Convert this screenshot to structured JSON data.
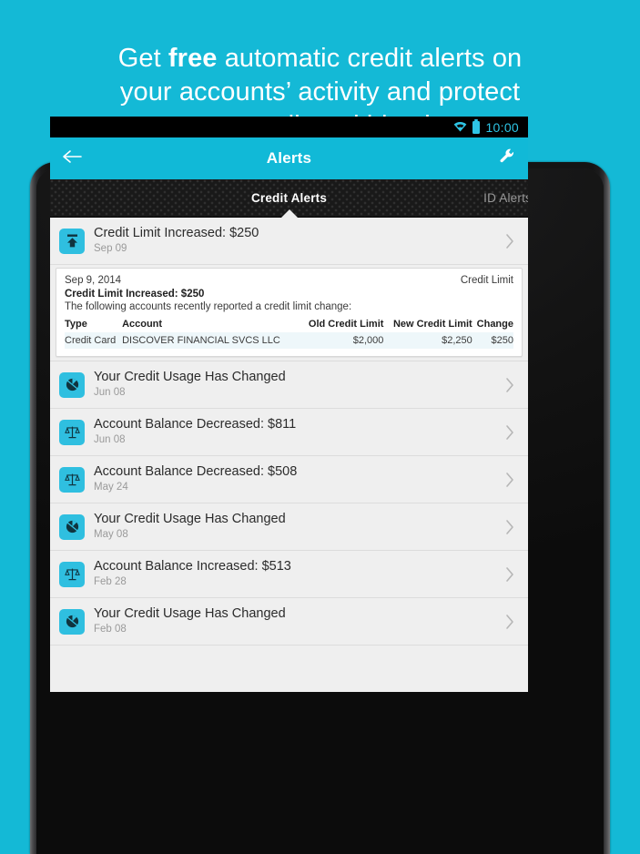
{
  "marketing": {
    "line1_pre": "Get ",
    "line1_bold": "free",
    "line1_post": " automatic credit alerts on",
    "line2": "your accounts’ activity and protect",
    "line3": "your credit and identity."
  },
  "colors": {
    "brand_teal": "#14b9d6",
    "appbar_teal": "#11b9d7",
    "icon_teal": "#2fbfe0",
    "status_accent": "#2ec5e6",
    "list_bg": "#efefef",
    "tab_inactive": "#9a9a9a"
  },
  "statusbar": {
    "wifi_icon": "wifi-icon",
    "battery_icon": "battery-icon",
    "time": "10:00"
  },
  "appbar": {
    "back_icon": "back-arrow-icon",
    "title": "Alerts",
    "settings_icon": "wrench-icon"
  },
  "tabs": [
    {
      "id": "credit-alerts",
      "label": "Credit Alerts",
      "active": true
    },
    {
      "id": "id-alerts",
      "label": "ID Alerts",
      "active": false
    }
  ],
  "alerts": [
    {
      "icon": "credit-limit-increase-icon",
      "title": "Credit Limit Increased: $250",
      "date": "Sep 09",
      "chevron": "chevron-right-icon",
      "expanded": true
    },
    {
      "icon": "credit-usage-pie-icon",
      "title": "Your Credit Usage Has Changed",
      "date": "Jun 08",
      "chevron": "chevron-right-icon",
      "expanded": false
    },
    {
      "icon": "account-balance-scales-icon",
      "title": "Account Balance Decreased: $811",
      "date": "Jun 08",
      "chevron": "chevron-right-icon",
      "expanded": false
    },
    {
      "icon": "account-balance-scales-icon",
      "title": "Account Balance Decreased: $508",
      "date": "May 24",
      "chevron": "chevron-right-icon",
      "expanded": false
    },
    {
      "icon": "credit-usage-pie-icon",
      "title": "Your Credit Usage Has Changed",
      "date": "May 08",
      "chevron": "chevron-right-icon",
      "expanded": false
    },
    {
      "icon": "account-balance-scales-icon",
      "title": "Account Balance Increased: $513",
      "date": "Feb 28",
      "chevron": "chevron-right-icon",
      "expanded": false
    },
    {
      "icon": "credit-usage-pie-icon",
      "title": "Your Credit Usage Has Changed",
      "date": "Feb 08",
      "chevron": "chevron-right-icon",
      "expanded": false
    }
  ],
  "detail": {
    "date": "Sep 9, 2014",
    "category": "Credit Limit",
    "heading": "Credit Limit Increased: $250",
    "description": "The following accounts recently reported a credit limit change:",
    "columns": [
      "Type",
      "Account",
      "Old Credit Limit",
      "New Credit Limit",
      "Change"
    ],
    "rows": [
      [
        "Credit Card",
        "DISCOVER FINANCIAL SVCS LLC",
        "$2,000",
        "$2,250",
        "$250"
      ]
    ]
  }
}
